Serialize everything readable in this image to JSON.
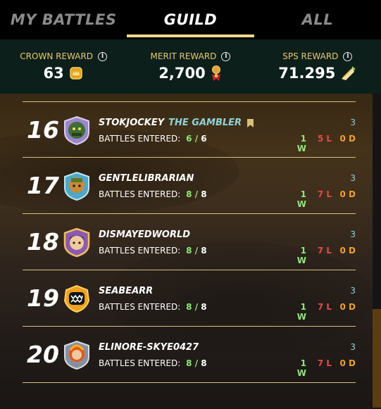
{
  "tabs": [
    {
      "label": "MY BATTLES",
      "active": false
    },
    {
      "label": "GUILD",
      "active": true
    },
    {
      "label": "ALL",
      "active": false
    }
  ],
  "rewards": [
    {
      "label": "CROWN REWARD",
      "value": "63",
      "icon": "crown-token-icon"
    },
    {
      "label": "MERIT REWARD",
      "value": "2,700",
      "icon": "merit-medal-icon"
    },
    {
      "label": "SPS REWARD",
      "value": "71.295",
      "icon": "sps-token-icon"
    }
  ],
  "rows": [
    {
      "rank": "16",
      "name": "STOKJOCKEY",
      "title": "THE GAMBLER",
      "battles_label": "BATTLES ENTERED:",
      "entered": "6",
      "total": "6",
      "count": "3",
      "wins": "1 W",
      "losses": "5 L",
      "draws": "0 D"
    },
    {
      "rank": "17",
      "name": "GENTLELIBRARIAN",
      "title": "",
      "battles_label": "BATTLES ENTERED:",
      "entered": "8",
      "total": "8",
      "count": "3",
      "wins": "1 W",
      "losses": "7 L",
      "draws": "0 D"
    },
    {
      "rank": "18",
      "name": "DISMAYEDWORLD",
      "title": "",
      "battles_label": "BATTLES ENTERED:",
      "entered": "8",
      "total": "8",
      "count": "3",
      "wins": "1 W",
      "losses": "7 L",
      "draws": "0 D"
    },
    {
      "rank": "19",
      "name": "SEABEARR",
      "title": "",
      "battles_label": "BATTLES ENTERED:",
      "entered": "8",
      "total": "8",
      "count": "3",
      "wins": "1 W",
      "losses": "7 L",
      "draws": "0 D"
    },
    {
      "rank": "20",
      "name": "ELINORE-SKYE0427",
      "title": "",
      "battles_label": "BATTLES ENTERED:",
      "entered": "8",
      "total": "8",
      "count": "3",
      "wins": "1 W",
      "losses": "7 L",
      "draws": "0 D"
    }
  ],
  "colors": {
    "accent": "#f1d98b",
    "win": "#8ee87a",
    "loss": "#e24a4a",
    "draw": "#f0a030",
    "teal": "#8fd3d8",
    "header_bg": "#0d1f1a"
  }
}
